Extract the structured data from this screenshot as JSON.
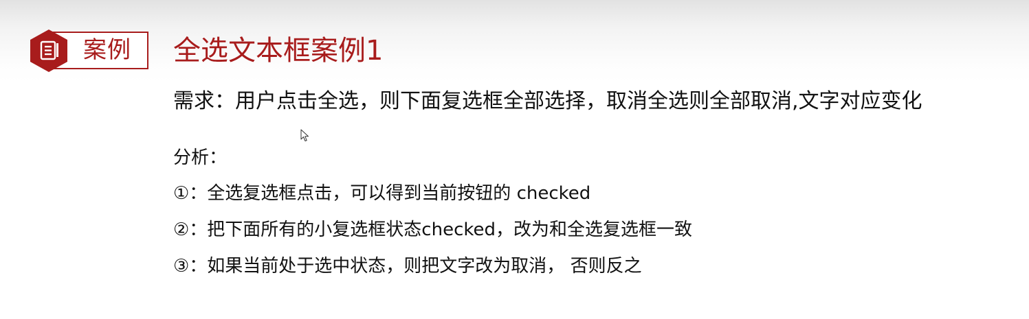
{
  "badge": {
    "label": "案例",
    "icon": "document-icon",
    "accent_color": "#a81c1c"
  },
  "title": "全选文本框案例1",
  "requirement": "需求：用户点击全选，则下面复选框全部选择，取消全选则全部取消,文字对应变化",
  "analysis": {
    "heading": "分析：",
    "steps": [
      "①：全选复选框点击，可以得到当前按钮的 checked",
      "②：把下面所有的小复选框状态checked，改为和全选复选框一致",
      "③：如果当前处于选中状态，则把文字改为取消， 否则反之"
    ]
  }
}
